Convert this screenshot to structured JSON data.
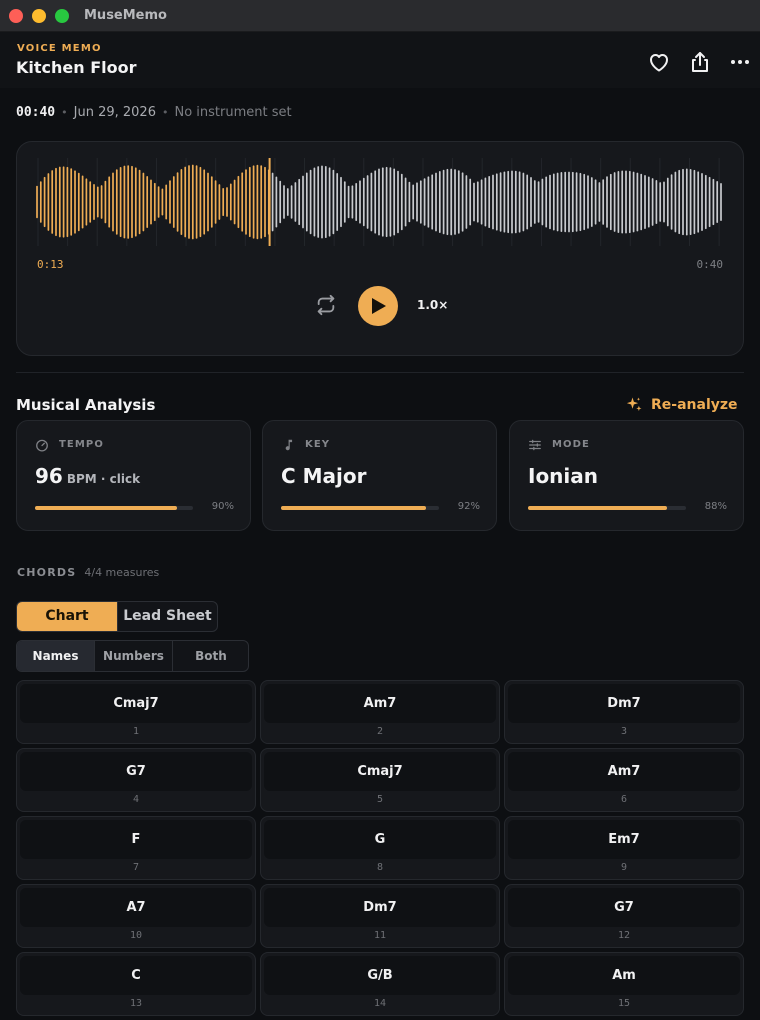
{
  "window": {
    "app_title": "MuseMemo"
  },
  "header": {
    "kicker": "VOICE MEMO",
    "title": "Kitchen Floor",
    "icons": [
      "heart-icon",
      "share-icon",
      "more-icon"
    ]
  },
  "meta": {
    "duration": "00:40",
    "separator": "•",
    "date": "Jun 29, 2026",
    "instrument": "No instrument set"
  },
  "player": {
    "elapsed": "0:13",
    "total": "0:40",
    "progress": 0.34,
    "speed": "1.0×",
    "accent_color": "#efad54",
    "played_color": "#efad54",
    "unplayed_color": "#c9cbcf"
  },
  "analysis": {
    "title": "Musical Analysis",
    "reanalyze_label": "Re-analyze",
    "cards": [
      {
        "label": "TEMPO",
        "icon": "gauge-icon",
        "value": "96",
        "sub": "BPM · click",
        "confidence": 0.9,
        "confidence_label": "90%"
      },
      {
        "label": "KEY",
        "icon": "music-note-icon",
        "value": "C Major",
        "sub": "",
        "confidence": 0.92,
        "confidence_label": "92%"
      },
      {
        "label": "MODE",
        "icon": "sliders-icon",
        "value": "Ionian",
        "sub": "",
        "confidence": 0.88,
        "confidence_label": "88%"
      }
    ]
  },
  "chords": {
    "heading": "CHORDS",
    "measures": "4/4 measures",
    "view_tabs": [
      "Chart",
      "Lead Sheet"
    ],
    "active_view": "Chart",
    "label_modes": [
      "Names",
      "Numbers",
      "Both"
    ],
    "active_label_mode": "Names",
    "items": [
      {
        "name": "Cmaj7",
        "num": "1"
      },
      {
        "name": "Am7",
        "num": "2"
      },
      {
        "name": "Dm7",
        "num": "3"
      },
      {
        "name": "G7",
        "num": "4"
      },
      {
        "name": "Cmaj7",
        "num": "5"
      },
      {
        "name": "Am7",
        "num": "6"
      },
      {
        "name": "F",
        "num": "7"
      },
      {
        "name": "G",
        "num": "8"
      },
      {
        "name": "Em7",
        "num": "9"
      },
      {
        "name": "A7",
        "num": "10"
      },
      {
        "name": "Dm7",
        "num": "11"
      },
      {
        "name": "G7",
        "num": "12"
      },
      {
        "name": "C",
        "num": "13"
      },
      {
        "name": "G/B",
        "num": "14"
      },
      {
        "name": "Am",
        "num": "15"
      }
    ]
  }
}
